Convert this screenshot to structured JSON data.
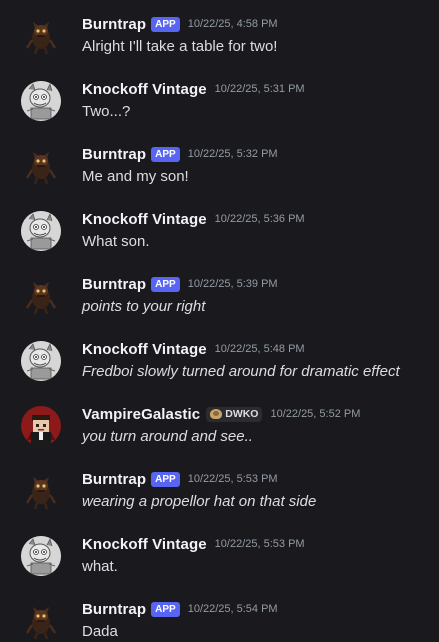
{
  "app_tag": "APP",
  "messages": [
    {
      "user": "Burntrap",
      "bot": true,
      "time": "10/22/25, 4:58 PM",
      "text": "Alright I'll take a table for two!",
      "italic": false,
      "avatar": "burntrap"
    },
    {
      "user": "Knockoff Vintage",
      "bot": false,
      "time": "10/22/25, 5:31 PM",
      "text": "Two...?",
      "italic": false,
      "avatar": "knockoff"
    },
    {
      "user": "Burntrap",
      "bot": true,
      "time": "10/22/25, 5:32 PM",
      "text": "Me and my son!",
      "italic": false,
      "avatar": "burntrap"
    },
    {
      "user": "Knockoff Vintage",
      "bot": false,
      "time": "10/22/25, 5:36 PM",
      "text": "What son.",
      "italic": false,
      "avatar": "knockoff"
    },
    {
      "user": "Burntrap",
      "bot": true,
      "time": "10/22/25, 5:39 PM",
      "text": "points to your right",
      "italic": true,
      "avatar": "burntrap"
    },
    {
      "user": "Knockoff Vintage",
      "bot": false,
      "time": "10/22/25, 5:48 PM",
      "text": "Fredboi slowly turned around for dramatic effect",
      "italic": true,
      "avatar": "knockoff"
    },
    {
      "user": "VampireGalastic",
      "bot": false,
      "guild_tag": "DWKO",
      "time": "10/22/25, 5:52 PM",
      "text": "you turn around and see..",
      "italic": true,
      "avatar": "vampire"
    },
    {
      "user": "Burntrap",
      "bot": true,
      "time": "10/22/25, 5:53 PM",
      "text": "wearing a propellor hat on that side",
      "italic": true,
      "avatar": "burntrap"
    },
    {
      "user": "Knockoff Vintage",
      "bot": false,
      "time": "10/22/25, 5:53 PM",
      "text": "what.",
      "italic": false,
      "avatar": "knockoff"
    },
    {
      "user": "Burntrap",
      "bot": true,
      "time": "10/22/25, 5:54 PM",
      "text": "Dada",
      "italic": false,
      "avatar": "burntrap"
    }
  ],
  "colors": {
    "background": "#1a1a1e",
    "app_tag": "#5865f2",
    "username": "#f2f3f5",
    "timestamp": "#949ba4",
    "message_text": "#dbdee1"
  }
}
